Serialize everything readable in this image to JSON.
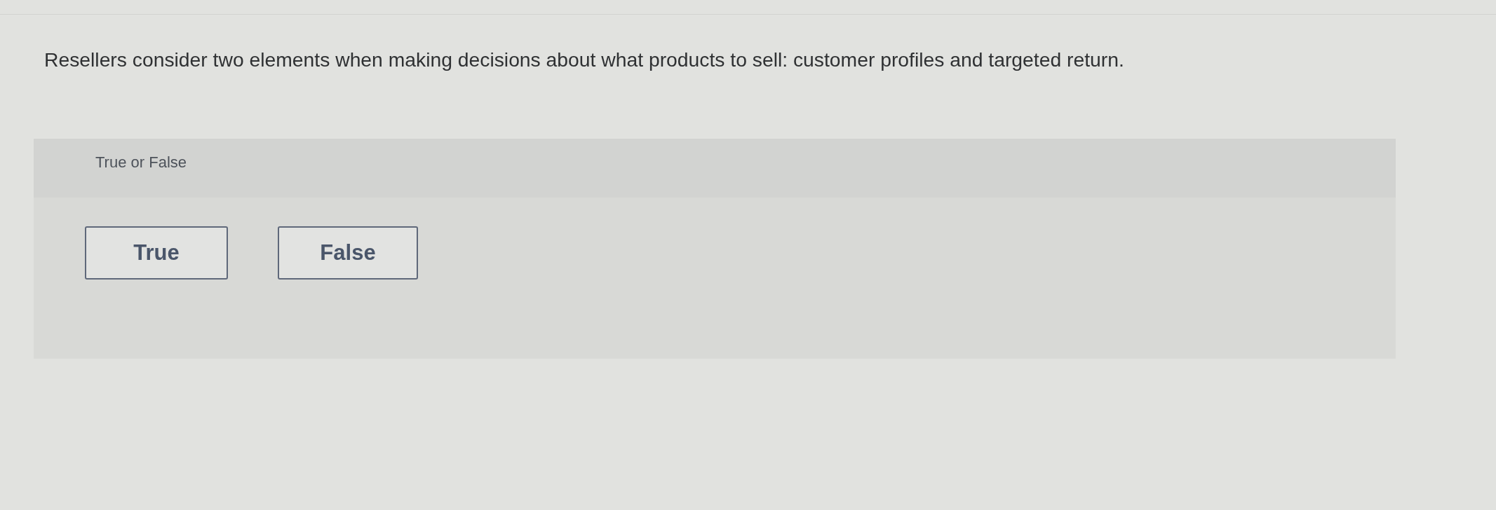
{
  "question": {
    "text": "Resellers consider two elements when making decisions about what products to sell: customer profiles and targeted return."
  },
  "answer_panel": {
    "prompt": "True or False",
    "options": [
      {
        "label": "True",
        "selected": false
      },
      {
        "label": "False",
        "selected": false
      }
    ]
  }
}
